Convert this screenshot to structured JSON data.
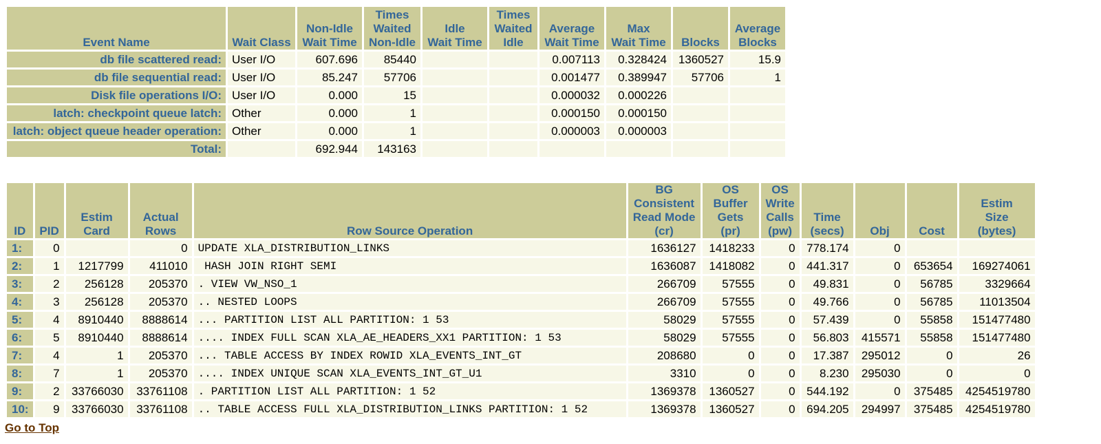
{
  "wait_table": {
    "headers": [
      "Event Name",
      "Wait Class",
      "Non-Idle\nWait Time",
      "Times\nWaited\nNon-Idle",
      "Idle\nWait Time",
      "Times\nWaited\nIdle",
      "Average\nWait Time",
      "Max\nWait Time",
      "Blocks",
      "Average\nBlocks"
    ],
    "rows": [
      [
        "db file scattered read:",
        "User I/O",
        "607.696",
        "85440",
        "",
        "",
        "0.007113",
        "0.328424",
        "1360527",
        "15.9"
      ],
      [
        "db file sequential read:",
        "User I/O",
        "85.247",
        "57706",
        "",
        "",
        "0.001477",
        "0.389947",
        "57706",
        "1"
      ],
      [
        "Disk file operations I/O:",
        "User I/O",
        "0.000",
        "15",
        "",
        "",
        "0.000032",
        "0.000226",
        "",
        ""
      ],
      [
        "latch: checkpoint queue latch:",
        "Other",
        "0.000",
        "1",
        "",
        "",
        "0.000150",
        "0.000150",
        "",
        ""
      ],
      [
        "latch: object queue header operation:",
        "Other",
        "0.000",
        "1",
        "",
        "",
        "0.000003",
        "0.000003",
        "",
        ""
      ],
      [
        "Total:",
        "",
        "692.944",
        "143163",
        "",
        "",
        "",
        "",
        "",
        ""
      ]
    ]
  },
  "plan_table": {
    "headers": [
      "ID",
      "PID",
      "Estim\nCard",
      "Actual\nRows",
      "Row Source Operation",
      "BG\nConsistent\nRead Mode\n(cr)",
      "OS\nBuffer\nGets\n(pr)",
      "OS\nWrite\nCalls\n(pw)",
      "Time\n(secs)",
      "Obj",
      "Cost",
      "Estim\nSize\n(bytes)"
    ],
    "rows": [
      [
        "1:",
        "0",
        "",
        "0",
        "UPDATE XLA_DISTRIBUTION_LINKS",
        "1636127",
        "1418233",
        "0",
        "778.174",
        "0",
        "",
        ""
      ],
      [
        "2:",
        "1",
        "1217799",
        "411010",
        " HASH JOIN RIGHT SEMI",
        "1636087",
        "1418082",
        "0",
        "441.317",
        "0",
        "653654",
        "169274061"
      ],
      [
        "3:",
        "2",
        "256128",
        "205370",
        ". VIEW VW_NSO_1",
        "266709",
        "57555",
        "0",
        "49.831",
        "0",
        "56785",
        "3329664"
      ],
      [
        "4:",
        "3",
        "256128",
        "205370",
        ".. NESTED LOOPS",
        "266709",
        "57555",
        "0",
        "49.766",
        "0",
        "56785",
        "11013504"
      ],
      [
        "5:",
        "4",
        "8910440",
        "8888614",
        "... PARTITION LIST ALL PARTITION: 1 53",
        "58029",
        "57555",
        "0",
        "57.439",
        "0",
        "55858",
        "151477480"
      ],
      [
        "6:",
        "5",
        "8910440",
        "8888614",
        ".... INDEX FULL SCAN XLA_AE_HEADERS_XX1 PARTITION: 1 53",
        "58029",
        "57555",
        "0",
        "56.803",
        "415571",
        "55858",
        "151477480"
      ],
      [
        "7:",
        "4",
        "1",
        "205370",
        "... TABLE ACCESS BY INDEX ROWID XLA_EVENTS_INT_GT",
        "208680",
        "0",
        "0",
        "17.387",
        "295012",
        "0",
        "26"
      ],
      [
        "8:",
        "7",
        "1",
        "205370",
        ".... INDEX UNIQUE SCAN XLA_EVENTS_INT_GT_U1",
        "3310",
        "0",
        "0",
        "8.230",
        "295030",
        "0",
        "0"
      ],
      [
        "9:",
        "2",
        "33766030",
        "33761108",
        ". PARTITION LIST ALL PARTITION: 1 52",
        "1369378",
        "1360527",
        "0",
        "544.192",
        "0",
        "375485",
        "4254519780"
      ],
      [
        "10:",
        "9",
        "33766030",
        "33761108",
        ".. TABLE ACCESS FULL XLA_DISTRIBUTION_LINKS PARTITION: 1 52",
        "1369378",
        "1360527",
        "0",
        "694.205",
        "294997",
        "375485",
        "4254519780"
      ]
    ]
  },
  "footer": {
    "go_to_top": "Go to Top"
  }
}
